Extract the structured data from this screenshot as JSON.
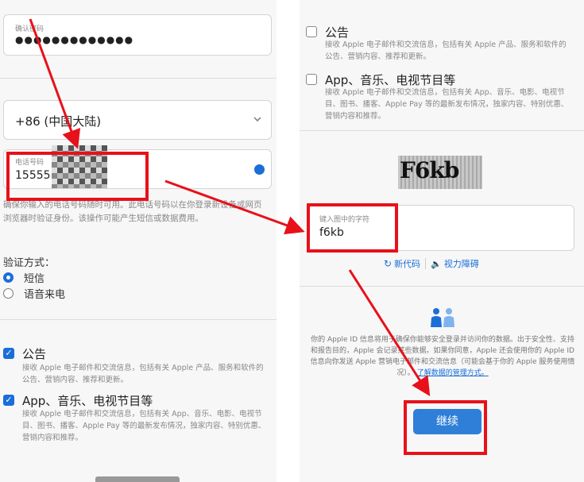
{
  "left": {
    "confirm_password": {
      "label": "确认密码",
      "value": "●●●●●●●●●●●●●"
    },
    "country_code": {
      "value": "+86 (中国大陆)"
    },
    "phone": {
      "label": "电话号码",
      "value": "15555"
    },
    "phone_help": "确保你输入的电话号码随时可用。此电话号码以在你登录新设备或网页浏览器时验证身份。该操作可能产生短信或数据费用。",
    "verify_title": "验证方式：",
    "verify_options": [
      {
        "label": "短信",
        "selected": true
      },
      {
        "label": "语音来电",
        "selected": false
      }
    ],
    "subscriptions": [
      {
        "title": "公告",
        "desc": "接收 Apple 电子邮件和交流信息，包括有关 Apple 产品、服务和软件的公告、营销内容、推荐和更新。",
        "checked": true
      },
      {
        "title": "App、音乐、电视节目等",
        "desc": "接收 Apple 电子邮件和交流信息，包括有关 App、音乐、电影、电视节目、图书、播客、Apple Pay 等的最新发布情况，独家内容、特别优惠、营销内容和推荐。",
        "checked": true
      }
    ]
  },
  "right": {
    "subscriptions": [
      {
        "title": "公告",
        "desc": "接收 Apple 电子邮件和交流信息，包括有关 Apple 产品、服务和软件的公告、营销内容、推荐和更新。",
        "checked": false
      },
      {
        "title": "App、音乐、电视节目等",
        "desc": "接收 Apple 电子邮件和交流信息，包括有关 App、音乐、电影、电视节目、图书、播客、Apple Pay 等的最新发布情况，独家内容、特别优惠、营销内容和推荐。",
        "checked": false
      }
    ],
    "captcha_image_text": "F6kb",
    "captcha": {
      "label": "键入图中的字符",
      "value": "f6kb"
    },
    "new_code_label": "新代码",
    "vision_impaired_label": "视力障碍",
    "privacy_text": "你的 Apple ID 信息将用于确保你能够安全登录并访问你的数据。出于安全性、支持和报告目的，Apple 会记录某些数据。如果你同意，Apple 还会使用你的 Apple ID 信息向你发送 Apple 营销电子邮件和交流信息（可能会基于你的 Apple 服务使用情况）。",
    "privacy_link": "了解数据的管理方式。",
    "continue_label": "继续"
  },
  "colors": {
    "accent": "#1a6ed8",
    "annotation_red": "#e8101a",
    "link": "#1a6ed8"
  }
}
